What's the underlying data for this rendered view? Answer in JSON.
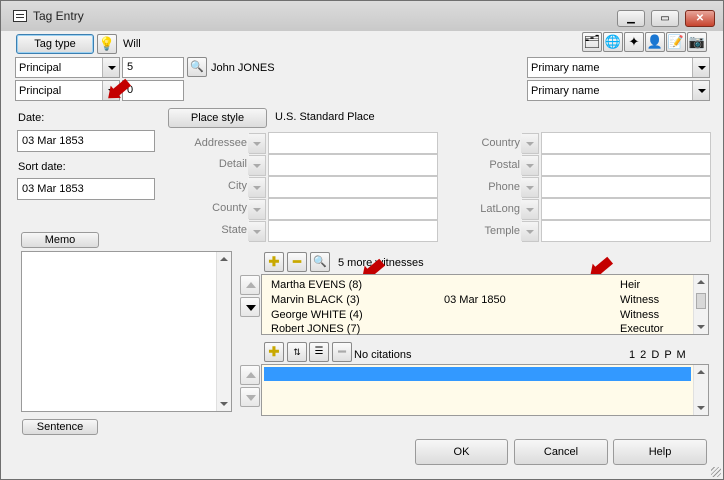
{
  "window": {
    "title": "Tag Entry"
  },
  "tag": {
    "button_label": "Tag type",
    "name": "Will"
  },
  "principal1": {
    "role": "Principal",
    "number": "5",
    "person_name": "John JONES",
    "name_type": "Primary name"
  },
  "principal2": {
    "role": "Principal",
    "number": "0",
    "name_type": "Primary name"
  },
  "date": {
    "label": "Date:",
    "value": "03 Mar 1853"
  },
  "sort_date": {
    "label": "Sort date:",
    "value": "03 Mar 1853"
  },
  "place": {
    "button_label": "Place style",
    "style_value": "U.S. Standard Place"
  },
  "place_fields_left": [
    "Addressee",
    "Detail",
    "City",
    "County",
    "State"
  ],
  "place_fields_right": [
    "Country",
    "Postal",
    "Phone",
    "LatLong",
    "Temple"
  ],
  "memo": {
    "button_label": "Memo"
  },
  "sentence": {
    "button_label": "Sentence"
  },
  "witnesses": {
    "summary": "5 more witnesses",
    "rows": [
      {
        "name": "Martha EVENS (8)",
        "date": "",
        "role": "Heir"
      },
      {
        "name": "Marvin BLACK (3)",
        "date": "03 Mar 1850",
        "role": "Witness"
      },
      {
        "name": "George WHITE (4)",
        "date": "",
        "role": "Witness"
      },
      {
        "name": "Robert JONES (7)",
        "date": "",
        "role": "Executor"
      }
    ]
  },
  "citations": {
    "summary": "No citations",
    "flags": "1 2 D P M"
  },
  "footer": {
    "ok_label": "OK",
    "cancel_label": "Cancel",
    "help_label": "Help"
  },
  "colors": {
    "selection": "#3399ff",
    "list_bg": "#fffbea",
    "red_pointer": "#c40000"
  }
}
